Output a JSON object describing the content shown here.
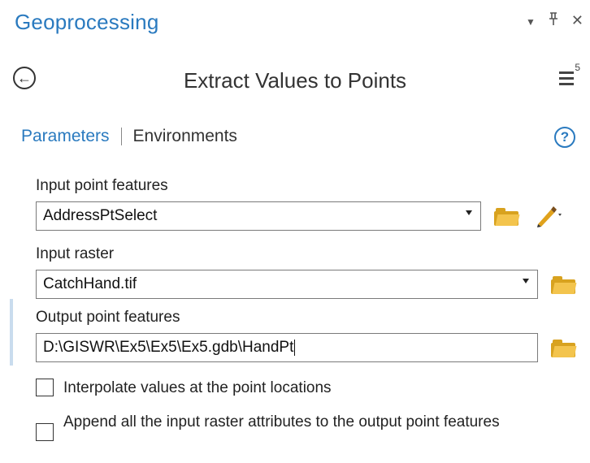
{
  "pane": {
    "title": "Geoprocessing",
    "controls": {
      "dropdown": "▾",
      "pin": "ᵖ",
      "close": "×"
    }
  },
  "tool": {
    "title": "Extract Values to Points",
    "menu_badge": "5"
  },
  "tabs": {
    "active": "Parameters",
    "other": "Environments",
    "help": "?"
  },
  "params": {
    "input_points": {
      "label": "Input point features",
      "value": "AddressPtSelect"
    },
    "input_raster": {
      "label": "Input raster",
      "value": "CatchHand.tif"
    },
    "output_points": {
      "label": "Output point features",
      "value": "D:\\GISWR\\Ex5\\Ex5\\Ex5.gdb\\HandPt"
    },
    "interpolate": {
      "label": "Interpolate values at the point locations",
      "checked": false
    },
    "append": {
      "label": "Append all the input raster attributes to the output point features",
      "checked": false
    }
  },
  "icons": [
    "back-icon",
    "menu-icon",
    "help-icon",
    "folder-icon",
    "pencil-icon",
    "dropdown-icon",
    "pin-icon",
    "close-icon"
  ],
  "colors": {
    "accent": "#2a7abf",
    "folder": "#f3c44d"
  }
}
